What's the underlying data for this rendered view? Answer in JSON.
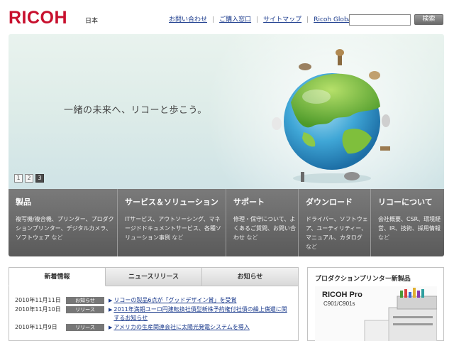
{
  "header": {
    "logo": "RICOH",
    "region": "日本",
    "links": [
      "お問い合わせ",
      "ご購入窓口",
      "サイトマップ",
      "Ricoh Global"
    ],
    "search_value": "",
    "search_button": "検索"
  },
  "hero": {
    "slogan": "一緒の未来へ、リコーと歩こう。",
    "pager": [
      "1",
      "2",
      "3"
    ],
    "active_page": "3"
  },
  "categories": [
    {
      "title": "製品",
      "desc": "複写機/複合機、プリンター、プロダクションプリンター、デジタルカメラ、ソフトウェア",
      "tail": "など"
    },
    {
      "title": "サービス＆ソリューション",
      "desc": "ITサービス、アウトソーシング、マネージドドキュメントサービス、各種ソリューション事例",
      "tail": "など"
    },
    {
      "title": "サポート",
      "desc": "修理・保守について、よくあるご質問、お問い合わせ",
      "tail": "など"
    },
    {
      "title": "ダウンロード",
      "desc": "ドライバー、ソフトウェア、ユーティリティー、マニュアル、カタログ",
      "tail": "など"
    },
    {
      "title": "リコーについて",
      "desc": "会社概要、CSR、環境経営、IR、技術、採用情報",
      "tail": "など"
    }
  ],
  "news": {
    "tabs": [
      "新着情報",
      "ニュースリリース",
      "お知らせ"
    ],
    "active_tab": "新着情報",
    "items": [
      {
        "date": "2010年11月11日",
        "badge": "お知らせ",
        "text": "リコーの製品6点が「グッドデザイン賞」を受賞"
      },
      {
        "date": "2010年11月10日",
        "badge": "リリース",
        "text": "2011年満期ユーロ円建転換社債型新株予約権付社債の繰上償還に関するお知らせ"
      },
      {
        "date": "2010年11月9日",
        "badge": "リリース",
        "text": "アメリカの生産関連会社に太陽光発電システムを導入"
      }
    ]
  },
  "promo": {
    "title": "プロダクションプリンター新製品",
    "product_name": "RICOH Pro",
    "product_model": "C901/C901s"
  },
  "colors": {
    "brand_red": "#c8102e",
    "link_blue": "#1a3a8c",
    "nav_gray": "#5a5a5a"
  }
}
